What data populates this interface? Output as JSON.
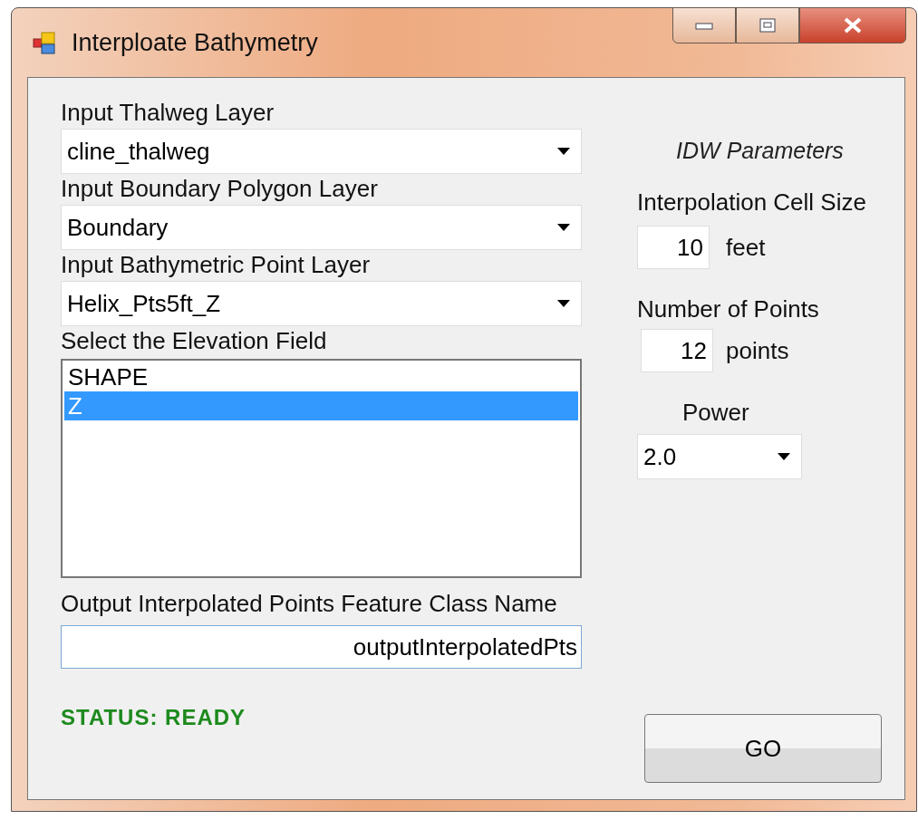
{
  "window": {
    "title": "Interploate Bathymetry"
  },
  "layers": [
    {
      "label": "Input Thalweg Layer",
      "value": "cline_thalweg"
    },
    {
      "label": "Input Boundary Polygon Layer",
      "value": "Boundary"
    },
    {
      "label": "Input Bathymetric Point Layer",
      "value": "Helix_Pts5ft_Z"
    }
  ],
  "elevation_field": {
    "label": "Select the Elevation Field",
    "items": [
      {
        "text": "SHAPE",
        "selected": false
      },
      {
        "text": "Z",
        "selected": true
      }
    ]
  },
  "output": {
    "label": "Output Interpolated Points Feature Class Name",
    "value": "outputInterpolatedPts"
  },
  "status": "STATUS: READY",
  "idw": {
    "title": "IDW Parameters",
    "cell_size": {
      "label": "Interpolation Cell Size",
      "value": "10",
      "unit": "feet"
    },
    "num_points": {
      "label": "Number of Points",
      "value": "12",
      "unit": "points"
    },
    "power": {
      "label": "Power",
      "value": "2.0"
    }
  },
  "go_button": "GO"
}
